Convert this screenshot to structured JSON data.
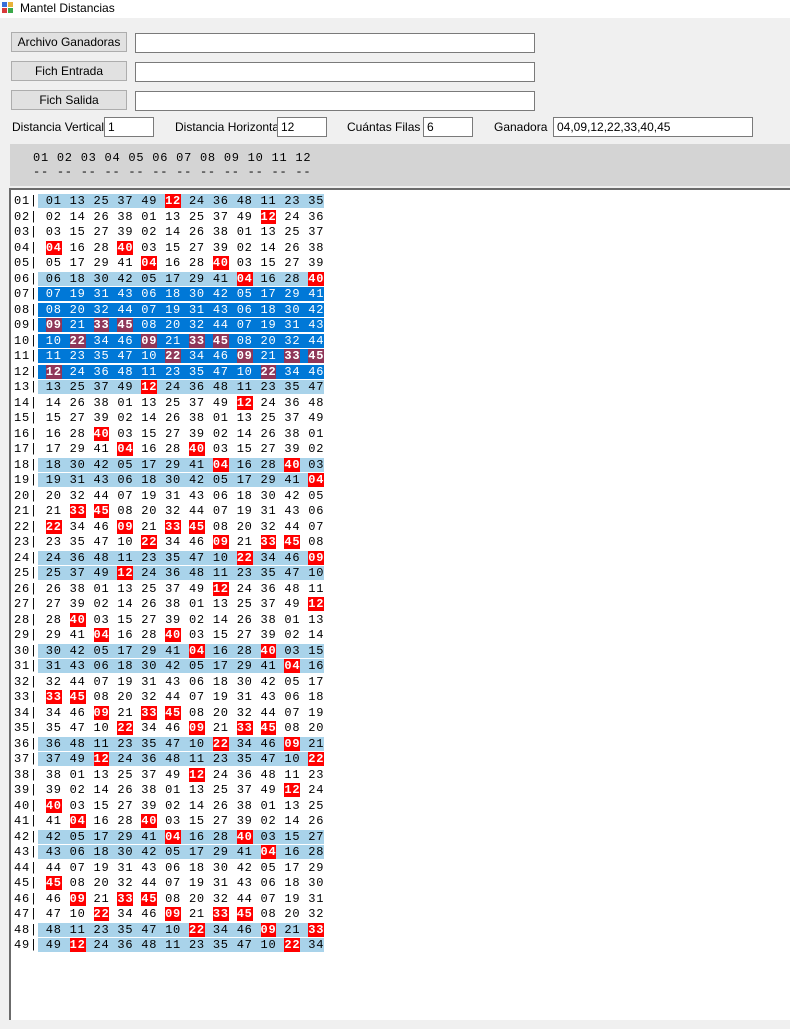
{
  "window": {
    "title": "Mantel Distancias"
  },
  "files": [
    {
      "button_label": "Archivo Ganadoras",
      "value": ""
    },
    {
      "button_label": "Fich Entrada",
      "value": ""
    },
    {
      "button_label": "Fich Salida",
      "value": ""
    }
  ],
  "params": {
    "vertical_label": "Distancia Vertical",
    "vertical_value": "1",
    "horizontal_label": "Distancia Horizontal",
    "horizontal_value": "12",
    "filas_label": "Cuántas Filas",
    "filas_value": "6",
    "ganadora_label": "Ganadora",
    "ganadora_value": "04,09,12,22,33,40,45"
  },
  "column_header": {
    "numbers": "01 02 03 04 05 06 07 08 09 10 11 12",
    "dashes": "-- -- -- -- -- -- -- -- -- -- -- --"
  },
  "colors": {
    "light_band": "#a9d3ea",
    "selected_band": "#0078d7",
    "hit_red": "#ff0000",
    "hit_selected": "#8f3659"
  },
  "grid": {
    "winning_numbers": [
      "04",
      "09",
      "12",
      "22",
      "33",
      "40",
      "45"
    ],
    "light_rows": [
      1,
      6,
      13,
      18,
      19,
      24,
      25,
      30,
      31,
      36,
      37,
      42,
      43,
      48,
      49
    ],
    "selected_rows": [
      7,
      8,
      9,
      10,
      11,
      12
    ],
    "rows": [
      {
        "label": "01|",
        "values": [
          "01",
          "13",
          "25",
          "37",
          "49",
          "12",
          "24",
          "36",
          "48",
          "11",
          "23",
          "35"
        ]
      },
      {
        "label": "02|",
        "values": [
          "02",
          "14",
          "26",
          "38",
          "01",
          "13",
          "25",
          "37",
          "49",
          "12",
          "24",
          "36"
        ]
      },
      {
        "label": "03|",
        "values": [
          "03",
          "15",
          "27",
          "39",
          "02",
          "14",
          "26",
          "38",
          "01",
          "13",
          "25",
          "37"
        ]
      },
      {
        "label": "04|",
        "values": [
          "04",
          "16",
          "28",
          "40",
          "03",
          "15",
          "27",
          "39",
          "02",
          "14",
          "26",
          "38"
        ]
      },
      {
        "label": "05|",
        "values": [
          "05",
          "17",
          "29",
          "41",
          "04",
          "16",
          "28",
          "40",
          "03",
          "15",
          "27",
          "39"
        ]
      },
      {
        "label": "06|",
        "values": [
          "06",
          "18",
          "30",
          "42",
          "05",
          "17",
          "29",
          "41",
          "04",
          "16",
          "28",
          "40"
        ]
      },
      {
        "label": "07|",
        "values": [
          "07",
          "19",
          "31",
          "43",
          "06",
          "18",
          "30",
          "42",
          "05",
          "17",
          "29",
          "41"
        ]
      },
      {
        "label": "08|",
        "values": [
          "08",
          "20",
          "32",
          "44",
          "07",
          "19",
          "31",
          "43",
          "06",
          "18",
          "30",
          "42"
        ]
      },
      {
        "label": "09|",
        "values": [
          "09",
          "21",
          "33",
          "45",
          "08",
          "20",
          "32",
          "44",
          "07",
          "19",
          "31",
          "43"
        ]
      },
      {
        "label": "10|",
        "values": [
          "10",
          "22",
          "34",
          "46",
          "09",
          "21",
          "33",
          "45",
          "08",
          "20",
          "32",
          "44"
        ]
      },
      {
        "label": "11|",
        "values": [
          "11",
          "23",
          "35",
          "47",
          "10",
          "22",
          "34",
          "46",
          "09",
          "21",
          "33",
          "45"
        ]
      },
      {
        "label": "12|",
        "values": [
          "12",
          "24",
          "36",
          "48",
          "11",
          "23",
          "35",
          "47",
          "10",
          "22",
          "34",
          "46"
        ]
      },
      {
        "label": "13|",
        "values": [
          "13",
          "25",
          "37",
          "49",
          "12",
          "24",
          "36",
          "48",
          "11",
          "23",
          "35",
          "47"
        ]
      },
      {
        "label": "14|",
        "values": [
          "14",
          "26",
          "38",
          "01",
          "13",
          "25",
          "37",
          "49",
          "12",
          "24",
          "36",
          "48"
        ]
      },
      {
        "label": "15|",
        "values": [
          "15",
          "27",
          "39",
          "02",
          "14",
          "26",
          "38",
          "01",
          "13",
          "25",
          "37",
          "49"
        ]
      },
      {
        "label": "16|",
        "values": [
          "16",
          "28",
          "40",
          "03",
          "15",
          "27",
          "39",
          "02",
          "14",
          "26",
          "38",
          "01"
        ]
      },
      {
        "label": "17|",
        "values": [
          "17",
          "29",
          "41",
          "04",
          "16",
          "28",
          "40",
          "03",
          "15",
          "27",
          "39",
          "02"
        ]
      },
      {
        "label": "18|",
        "values": [
          "18",
          "30",
          "42",
          "05",
          "17",
          "29",
          "41",
          "04",
          "16",
          "28",
          "40",
          "03"
        ]
      },
      {
        "label": "19|",
        "values": [
          "19",
          "31",
          "43",
          "06",
          "18",
          "30",
          "42",
          "05",
          "17",
          "29",
          "41",
          "04"
        ]
      },
      {
        "label": "20|",
        "values": [
          "20",
          "32",
          "44",
          "07",
          "19",
          "31",
          "43",
          "06",
          "18",
          "30",
          "42",
          "05"
        ]
      },
      {
        "label": "21|",
        "values": [
          "21",
          "33",
          "45",
          "08",
          "20",
          "32",
          "44",
          "07",
          "19",
          "31",
          "43",
          "06"
        ]
      },
      {
        "label": "22|",
        "values": [
          "22",
          "34",
          "46",
          "09",
          "21",
          "33",
          "45",
          "08",
          "20",
          "32",
          "44",
          "07"
        ]
      },
      {
        "label": "23|",
        "values": [
          "23",
          "35",
          "47",
          "10",
          "22",
          "34",
          "46",
          "09",
          "21",
          "33",
          "45",
          "08"
        ]
      },
      {
        "label": "24|",
        "values": [
          "24",
          "36",
          "48",
          "11",
          "23",
          "35",
          "47",
          "10",
          "22",
          "34",
          "46",
          "09"
        ]
      },
      {
        "label": "25|",
        "values": [
          "25",
          "37",
          "49",
          "12",
          "24",
          "36",
          "48",
          "11",
          "23",
          "35",
          "47",
          "10"
        ]
      },
      {
        "label": "26|",
        "values": [
          "26",
          "38",
          "01",
          "13",
          "25",
          "37",
          "49",
          "12",
          "24",
          "36",
          "48",
          "11"
        ]
      },
      {
        "label": "27|",
        "values": [
          "27",
          "39",
          "02",
          "14",
          "26",
          "38",
          "01",
          "13",
          "25",
          "37",
          "49",
          "12"
        ]
      },
      {
        "label": "28|",
        "values": [
          "28",
          "40",
          "03",
          "15",
          "27",
          "39",
          "02",
          "14",
          "26",
          "38",
          "01",
          "13"
        ]
      },
      {
        "label": "29|",
        "values": [
          "29",
          "41",
          "04",
          "16",
          "28",
          "40",
          "03",
          "15",
          "27",
          "39",
          "02",
          "14"
        ]
      },
      {
        "label": "30|",
        "values": [
          "30",
          "42",
          "05",
          "17",
          "29",
          "41",
          "04",
          "16",
          "28",
          "40",
          "03",
          "15"
        ]
      },
      {
        "label": "31|",
        "values": [
          "31",
          "43",
          "06",
          "18",
          "30",
          "42",
          "05",
          "17",
          "29",
          "41",
          "04",
          "16"
        ]
      },
      {
        "label": "32|",
        "values": [
          "32",
          "44",
          "07",
          "19",
          "31",
          "43",
          "06",
          "18",
          "30",
          "42",
          "05",
          "17"
        ]
      },
      {
        "label": "33|",
        "values": [
          "33",
          "45",
          "08",
          "20",
          "32",
          "44",
          "07",
          "19",
          "31",
          "43",
          "06",
          "18"
        ]
      },
      {
        "label": "34|",
        "values": [
          "34",
          "46",
          "09",
          "21",
          "33",
          "45",
          "08",
          "20",
          "32",
          "44",
          "07",
          "19"
        ]
      },
      {
        "label": "35|",
        "values": [
          "35",
          "47",
          "10",
          "22",
          "34",
          "46",
          "09",
          "21",
          "33",
          "45",
          "08",
          "20"
        ]
      },
      {
        "label": "36|",
        "values": [
          "36",
          "48",
          "11",
          "23",
          "35",
          "47",
          "10",
          "22",
          "34",
          "46",
          "09",
          "21"
        ]
      },
      {
        "label": "37|",
        "values": [
          "37",
          "49",
          "12",
          "24",
          "36",
          "48",
          "11",
          "23",
          "35",
          "47",
          "10",
          "22"
        ]
      },
      {
        "label": "38|",
        "values": [
          "38",
          "01",
          "13",
          "25",
          "37",
          "49",
          "12",
          "24",
          "36",
          "48",
          "11",
          "23"
        ]
      },
      {
        "label": "39|",
        "values": [
          "39",
          "02",
          "14",
          "26",
          "38",
          "01",
          "13",
          "25",
          "37",
          "49",
          "12",
          "24"
        ]
      },
      {
        "label": "40|",
        "values": [
          "40",
          "03",
          "15",
          "27",
          "39",
          "02",
          "14",
          "26",
          "38",
          "01",
          "13",
          "25"
        ]
      },
      {
        "label": "41|",
        "values": [
          "41",
          "04",
          "16",
          "28",
          "40",
          "03",
          "15",
          "27",
          "39",
          "02",
          "14",
          "26"
        ]
      },
      {
        "label": "42|",
        "values": [
          "42",
          "05",
          "17",
          "29",
          "41",
          "04",
          "16",
          "28",
          "40",
          "03",
          "15",
          "27"
        ]
      },
      {
        "label": "43|",
        "values": [
          "43",
          "06",
          "18",
          "30",
          "42",
          "05",
          "17",
          "29",
          "41",
          "04",
          "16",
          "28"
        ]
      },
      {
        "label": "44|",
        "values": [
          "44",
          "07",
          "19",
          "31",
          "43",
          "06",
          "18",
          "30",
          "42",
          "05",
          "17",
          "29"
        ]
      },
      {
        "label": "45|",
        "values": [
          "45",
          "08",
          "20",
          "32",
          "44",
          "07",
          "19",
          "31",
          "43",
          "06",
          "18",
          "30"
        ]
      },
      {
        "label": "46|",
        "values": [
          "46",
          "09",
          "21",
          "33",
          "45",
          "08",
          "20",
          "32",
          "44",
          "07",
          "19",
          "31"
        ]
      },
      {
        "label": "47|",
        "values": [
          "47",
          "10",
          "22",
          "34",
          "46",
          "09",
          "21",
          "33",
          "45",
          "08",
          "20",
          "32"
        ]
      },
      {
        "label": "48|",
        "values": [
          "48",
          "11",
          "23",
          "35",
          "47",
          "10",
          "22",
          "34",
          "46",
          "09",
          "21",
          "33"
        ]
      },
      {
        "label": "49|",
        "values": [
          "49",
          "12",
          "24",
          "36",
          "48",
          "11",
          "23",
          "35",
          "47",
          "10",
          "22",
          "34"
        ]
      }
    ]
  }
}
